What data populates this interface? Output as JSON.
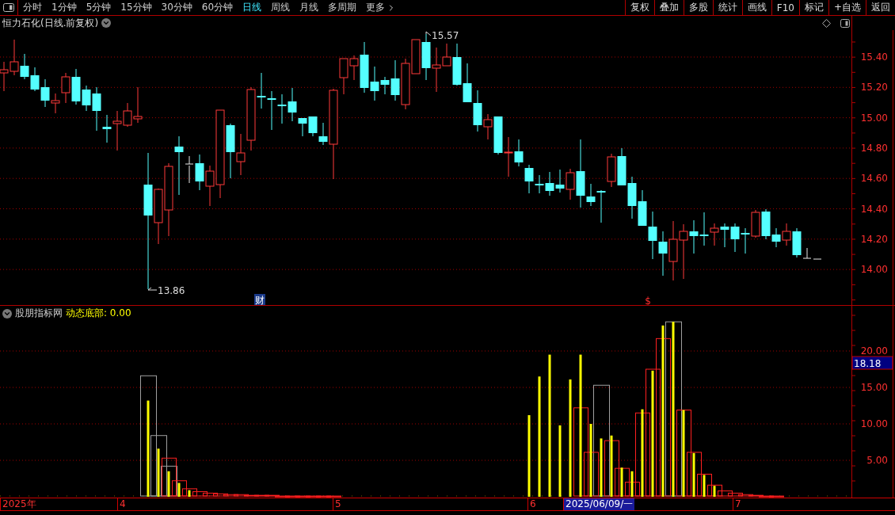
{
  "toolbar": {
    "periods": [
      {
        "label": "分时",
        "selected": false
      },
      {
        "label": "1分钟",
        "selected": false
      },
      {
        "label": "5分钟",
        "selected": false
      },
      {
        "label": "15分钟",
        "selected": false
      },
      {
        "label": "30分钟",
        "selected": false
      },
      {
        "label": "60分钟",
        "selected": false
      },
      {
        "label": "日线",
        "selected": true
      },
      {
        "label": "周线",
        "selected": false
      },
      {
        "label": "月线",
        "selected": false
      },
      {
        "label": "多周期",
        "selected": false
      },
      {
        "label": "更多",
        "selected": false
      }
    ],
    "buttons": [
      "复权",
      "叠加",
      "多股",
      "统计",
      "画线",
      "F10",
      "标记",
      "+自选",
      "返回"
    ]
  },
  "price_panel": {
    "title": "恒力石化(日线.前复权)",
    "y_ticks": [
      "15.40",
      "15.20",
      "15.00",
      "14.80",
      "14.60",
      "14.40",
      "14.20",
      "14.00"
    ],
    "high_label": "15.57",
    "low_label": "13.86",
    "markers": [
      {
        "kind": "finance",
        "text": "财"
      },
      {
        "kind": "dividend",
        "text": "$"
      }
    ]
  },
  "indicator_panel": {
    "name": "股朋指标网",
    "reading": "动态底部: 0.00",
    "current_value": "18.18",
    "y_ticks": [
      "20.00",
      "15.00",
      "10.00",
      "5.00"
    ]
  },
  "date_axis": [
    {
      "label": "2025年",
      "selected": false
    },
    {
      "label": "4",
      "selected": false
    },
    {
      "label": "5",
      "selected": false
    },
    {
      "label": "6",
      "selected": false
    },
    {
      "label": "2025/06/09/一",
      "selected": true
    },
    {
      "label": "7",
      "selected": false
    }
  ]
}
